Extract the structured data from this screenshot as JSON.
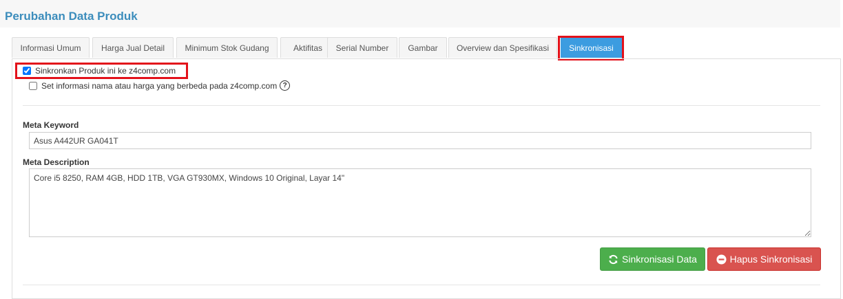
{
  "page": {
    "title": "Perubahan Data Produk"
  },
  "tabs": [
    {
      "label": "Informasi Umum"
    },
    {
      "label": "Harga Jual Detail"
    },
    {
      "label": "Minimum Stok Gudang"
    },
    {
      "label": "Aktifitas"
    },
    {
      "label": "Serial Number"
    },
    {
      "label": "Gambar"
    },
    {
      "label": "Overview dan Spesifikasi"
    },
    {
      "label": "Sinkronisasi"
    }
  ],
  "active_tab": "Sinkronisasi",
  "sync": {
    "checkbox1_label": "Sinkronkan Produk ini ke z4comp.com",
    "checkbox1_checked": true,
    "checkbox2_label": "Set informasi nama atau harga yang berbeda pada z4comp.com",
    "checkbox2_checked": false,
    "help_icon": "question-circle-icon"
  },
  "meta": {
    "keyword_label": "Meta Keyword",
    "keyword_value": "Asus A442UR GA041T",
    "description_label": "Meta Description",
    "description_value": "Core i5 8250, RAM 4GB, HDD 1TB, VGA GT930MX, Windows 10 Original, Layar 14\""
  },
  "buttons": {
    "sync_label": "Sinkronisasi Data",
    "sync_icon": "refresh-icon",
    "delete_label": "Hapus Sinkronisasi",
    "delete_icon": "minus-circle-icon"
  },
  "colors": {
    "accent": "#3c8dbc",
    "active_tab": "#3c9ce0",
    "highlight": "#e3111a",
    "success": "#4cae4c",
    "danger": "#d9534f"
  }
}
